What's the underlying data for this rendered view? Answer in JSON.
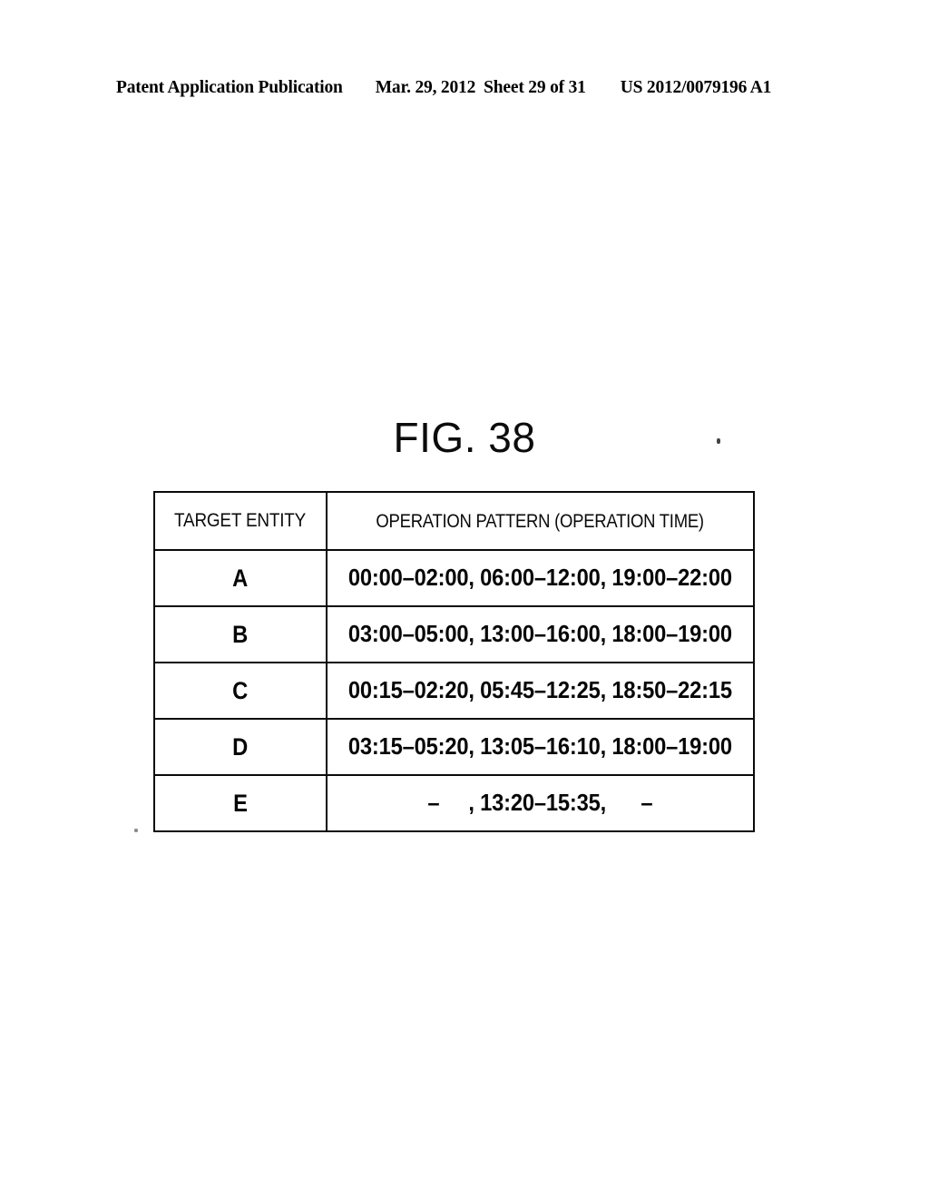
{
  "page_header": {
    "publication": "Patent Application Publication",
    "date": "Mar. 29, 2012",
    "sheet": "Sheet 29 of 31",
    "publication_number": "US 2012/0079196 A1"
  },
  "figure": {
    "title": "FIG. 38"
  },
  "table": {
    "columns": [
      "TARGET ENTITY",
      "OPERATION PATTERN (OPERATION TIME)"
    ],
    "rows": [
      {
        "entity": "A",
        "pattern": "00:00–02:00, 06:00–12:00, 19:00–22:00"
      },
      {
        "entity": "B",
        "pattern": "03:00–05:00, 13:00–16:00, 18:00–19:00"
      },
      {
        "entity": "C",
        "pattern": "00:15–02:20, 05:45–12:25, 18:50–22:15"
      },
      {
        "entity": "D",
        "pattern": "03:15–05:20, 13:05–16:10, 18:00–19:00"
      },
      {
        "entity": "E",
        "pattern": "–     , 13:20–15:35,      –"
      }
    ]
  }
}
